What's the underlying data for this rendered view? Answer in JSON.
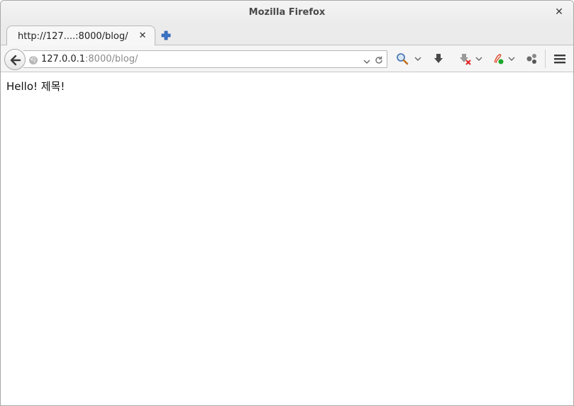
{
  "window": {
    "title": "Mozilla Firefox"
  },
  "tabs": [
    {
      "label": "http://127....:8000/blog/",
      "active": true
    }
  ],
  "navbar": {
    "url_host": "127.0.0.1",
    "url_path": ":8000/blog/"
  },
  "page": {
    "body_text": "Hello! 제목!"
  },
  "icons": {
    "back": "back-arrow-icon",
    "globe": "globe-icon",
    "search": "search-icon",
    "download": "download-icon",
    "addon_red": "addon-disabled-icon",
    "addon_green": "addon-status-icon",
    "share": "share-icon",
    "menu": "hamburger-menu-icon"
  },
  "colors": {
    "newtab_blue": "#3a73c8",
    "addon_red": "#e02020",
    "addon_green": "#1aa82a"
  }
}
